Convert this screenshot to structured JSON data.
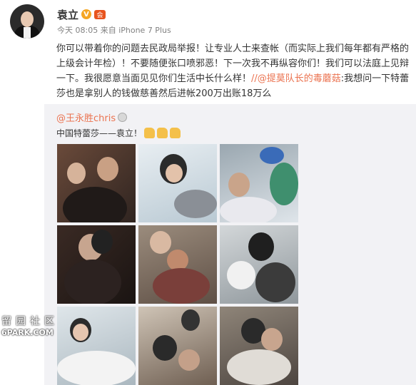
{
  "author": {
    "name": "袁立",
    "verified_badge": "V",
    "member_badge": "会",
    "meta": "今天 08:05 来自 iPhone 7 Plus"
  },
  "post": {
    "text_part1": "你可以带着你的问题去民政局举报！让专业人士来查帐（而实际上我们每年都有严格的上级会计年检）！不要随便张口喷邪恶！下一次我不再纵容你们！我们可以法庭上见辩一下。我很愿意当面见见你们生活中长什么样！",
    "mention": "//@提莫队长的毒蘑菇",
    "text_part2": ":我想问一下特蕾莎也是拿别人的钱做慈善然后进帐200万出账18万么"
  },
  "repost": {
    "author": "@王永胜chris",
    "text": "中国特蕾莎——袁立！",
    "emoji": "thumbs-up-icon"
  },
  "photos": [
    "photo-1",
    "photo-2",
    "photo-3",
    "photo-4",
    "photo-5",
    "photo-6",
    "photo-7",
    "photo-8",
    "photo-9"
  ],
  "watermark": {
    "chinese": "留园社区",
    "english": "6PARK.COM"
  },
  "colors": {
    "mention": "#eb7350",
    "repost_bg": "#f2f2f5",
    "meta": "#808080"
  }
}
